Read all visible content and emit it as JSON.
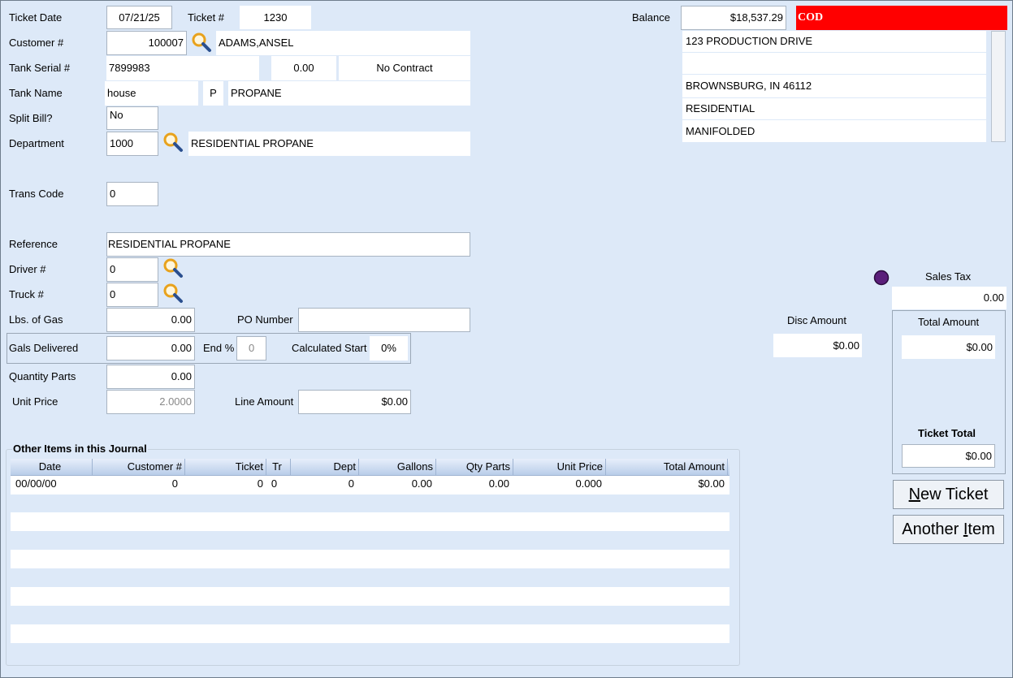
{
  "form": {
    "ticket_date_label": "Ticket Date",
    "ticket_date": "07/21/25",
    "ticket_no_label": "Ticket #",
    "ticket_no": "1230",
    "customer_label": "Customer #",
    "customer_no": "100007",
    "customer_name": "ADAMS,ANSEL",
    "tank_serial_label": "Tank Serial #",
    "tank_serial": "7899983",
    "tank_amount": "0.00",
    "contract": "No Contract",
    "tank_name_label": "Tank Name",
    "tank_name": "house",
    "product_code": "P",
    "product_name": "PROPANE",
    "split_bill_label": "Split Bill?",
    "split_bill": "No",
    "department_label": "Department",
    "department_no": "1000",
    "department_name": "RESIDENTIAL PROPANE",
    "trans_code_label": "Trans Code",
    "trans_code": "0",
    "reference_label": "Reference",
    "reference": "RESIDENTIAL PROPANE",
    "driver_label": "Driver #",
    "driver": "0",
    "truck_label": "Truck #",
    "truck": "0",
    "lbs_gas_label": "Lbs. of Gas",
    "lbs_gas": "0.00",
    "po_label": "PO Number",
    "po_number": "",
    "gals_label": "Gals Delivered",
    "gals": "0.00",
    "end_pct_label": "End %",
    "end_pct": "0",
    "calc_start_label": "Calculated Start",
    "calc_start": "0%",
    "qty_parts_label": "Quantity Parts",
    "qty_parts": "0.00",
    "unit_price_label": "Unit Price",
    "unit_price": "2.0000",
    "line_amount_label": "Line Amount",
    "line_amount": "$0.00"
  },
  "account": {
    "balance_label": "Balance",
    "balance": "$18,537.29",
    "terms": "COD",
    "terms_color": "#ff0000",
    "address": [
      "123 PRODUCTION DRIVE",
      "",
      "BROWNSBURG, IN 46112",
      "RESIDENTIAL",
      "MANIFOLDED"
    ]
  },
  "totals": {
    "sales_tax_label": "Sales Tax",
    "sales_tax": "0.00",
    "disc_label": "Disc Amount",
    "disc_amount": "$0.00",
    "total_label": "Total Amount",
    "total_amount": "$0.00",
    "ticket_total_label": "Ticket Total",
    "ticket_total": "$0.00"
  },
  "buttons": {
    "new_ticket_pre": "",
    "new_ticket_key": "N",
    "new_ticket_post": "ew Ticket",
    "another_pre": "Another ",
    "another_key": "I",
    "another_post": "tem"
  },
  "journal": {
    "title": "Other Items in this Journal",
    "columns": [
      "Date",
      "Customer #",
      "Ticket",
      "Tr",
      "Dept",
      "Gallons",
      "Qty Parts",
      "Unit Price",
      "Total Amount"
    ],
    "rows": [
      [
        "00/00/00",
        "0",
        "0",
        "0",
        "0",
        "0.00",
        "0.00",
        "0.000",
        "$0.00"
      ]
    ]
  }
}
